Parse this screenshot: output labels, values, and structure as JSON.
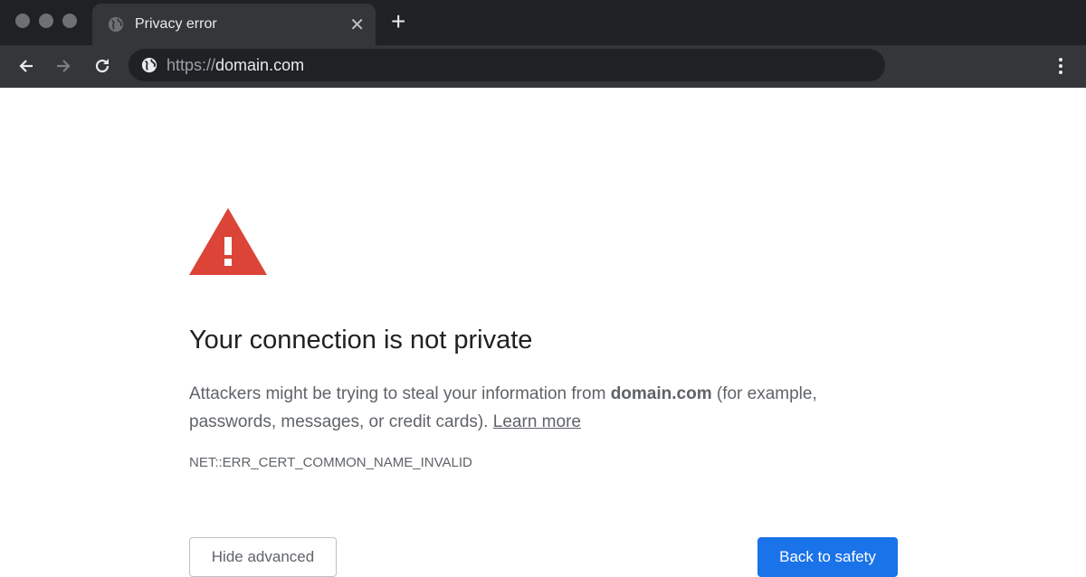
{
  "browser": {
    "tab": {
      "title": "Privacy error",
      "icon": "globe-icon"
    },
    "address_bar": {
      "scheme": "https://",
      "host": "domain.com"
    }
  },
  "page": {
    "heading": "Your connection is not private",
    "message_prefix": "Attackers might be trying to steal your information from ",
    "message_domain": "domain.com",
    "message_suffix": " (for example, passwords, messages, or credit cards). ",
    "learn_more": "Learn more",
    "error_code": "NET::ERR_CERT_COMMON_NAME_INVALID",
    "hide_advanced": "Hide advanced",
    "back_to_safety": "Back to safety"
  },
  "colors": {
    "warning": "#db4437",
    "primary": "#1a73e8"
  }
}
